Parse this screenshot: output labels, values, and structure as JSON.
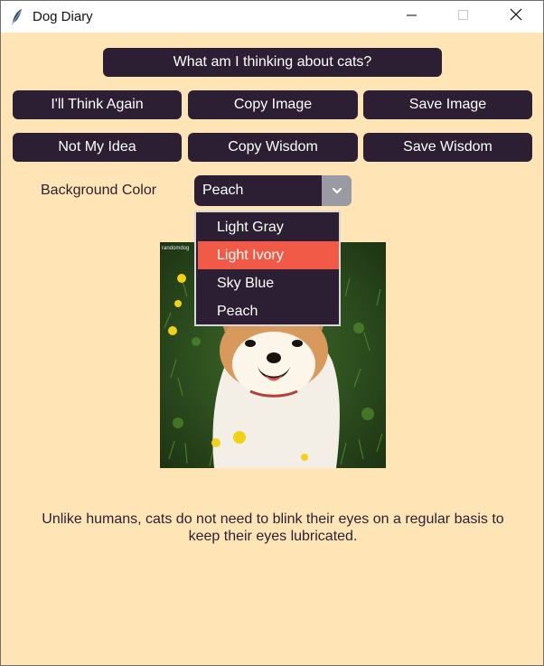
{
  "window": {
    "title": "Dog Diary",
    "icons": {
      "app": "feather-icon",
      "minimize": "minimize-icon",
      "maximize": "maximize-icon",
      "close": "close-icon"
    }
  },
  "buttons": {
    "thinking": "What am I thinking about cats?",
    "think_again": "I'll Think Again",
    "copy_image": "Copy Image",
    "save_image": "Save Image",
    "not_my_idea": "Not My Idea",
    "copy_wisdom": "Copy Wisdom",
    "save_wisdom": "Save Wisdom"
  },
  "background_color": {
    "label": "Background Color",
    "selected": "Peach",
    "options": [
      "Light Gray",
      "Light Ivory",
      "Sky Blue",
      "Peach"
    ],
    "highlighted": "Light Ivory"
  },
  "image": {
    "watermark": "randomdog"
  },
  "fact": "Unlike humans, cats do not need to blink their eyes on a regular basis to keep their eyes lubricated.",
  "colors": {
    "background": "#ffe4b5",
    "button": "#2d1f33",
    "highlight": "#f05a47",
    "combo_arrow": "#9a9aa4"
  }
}
